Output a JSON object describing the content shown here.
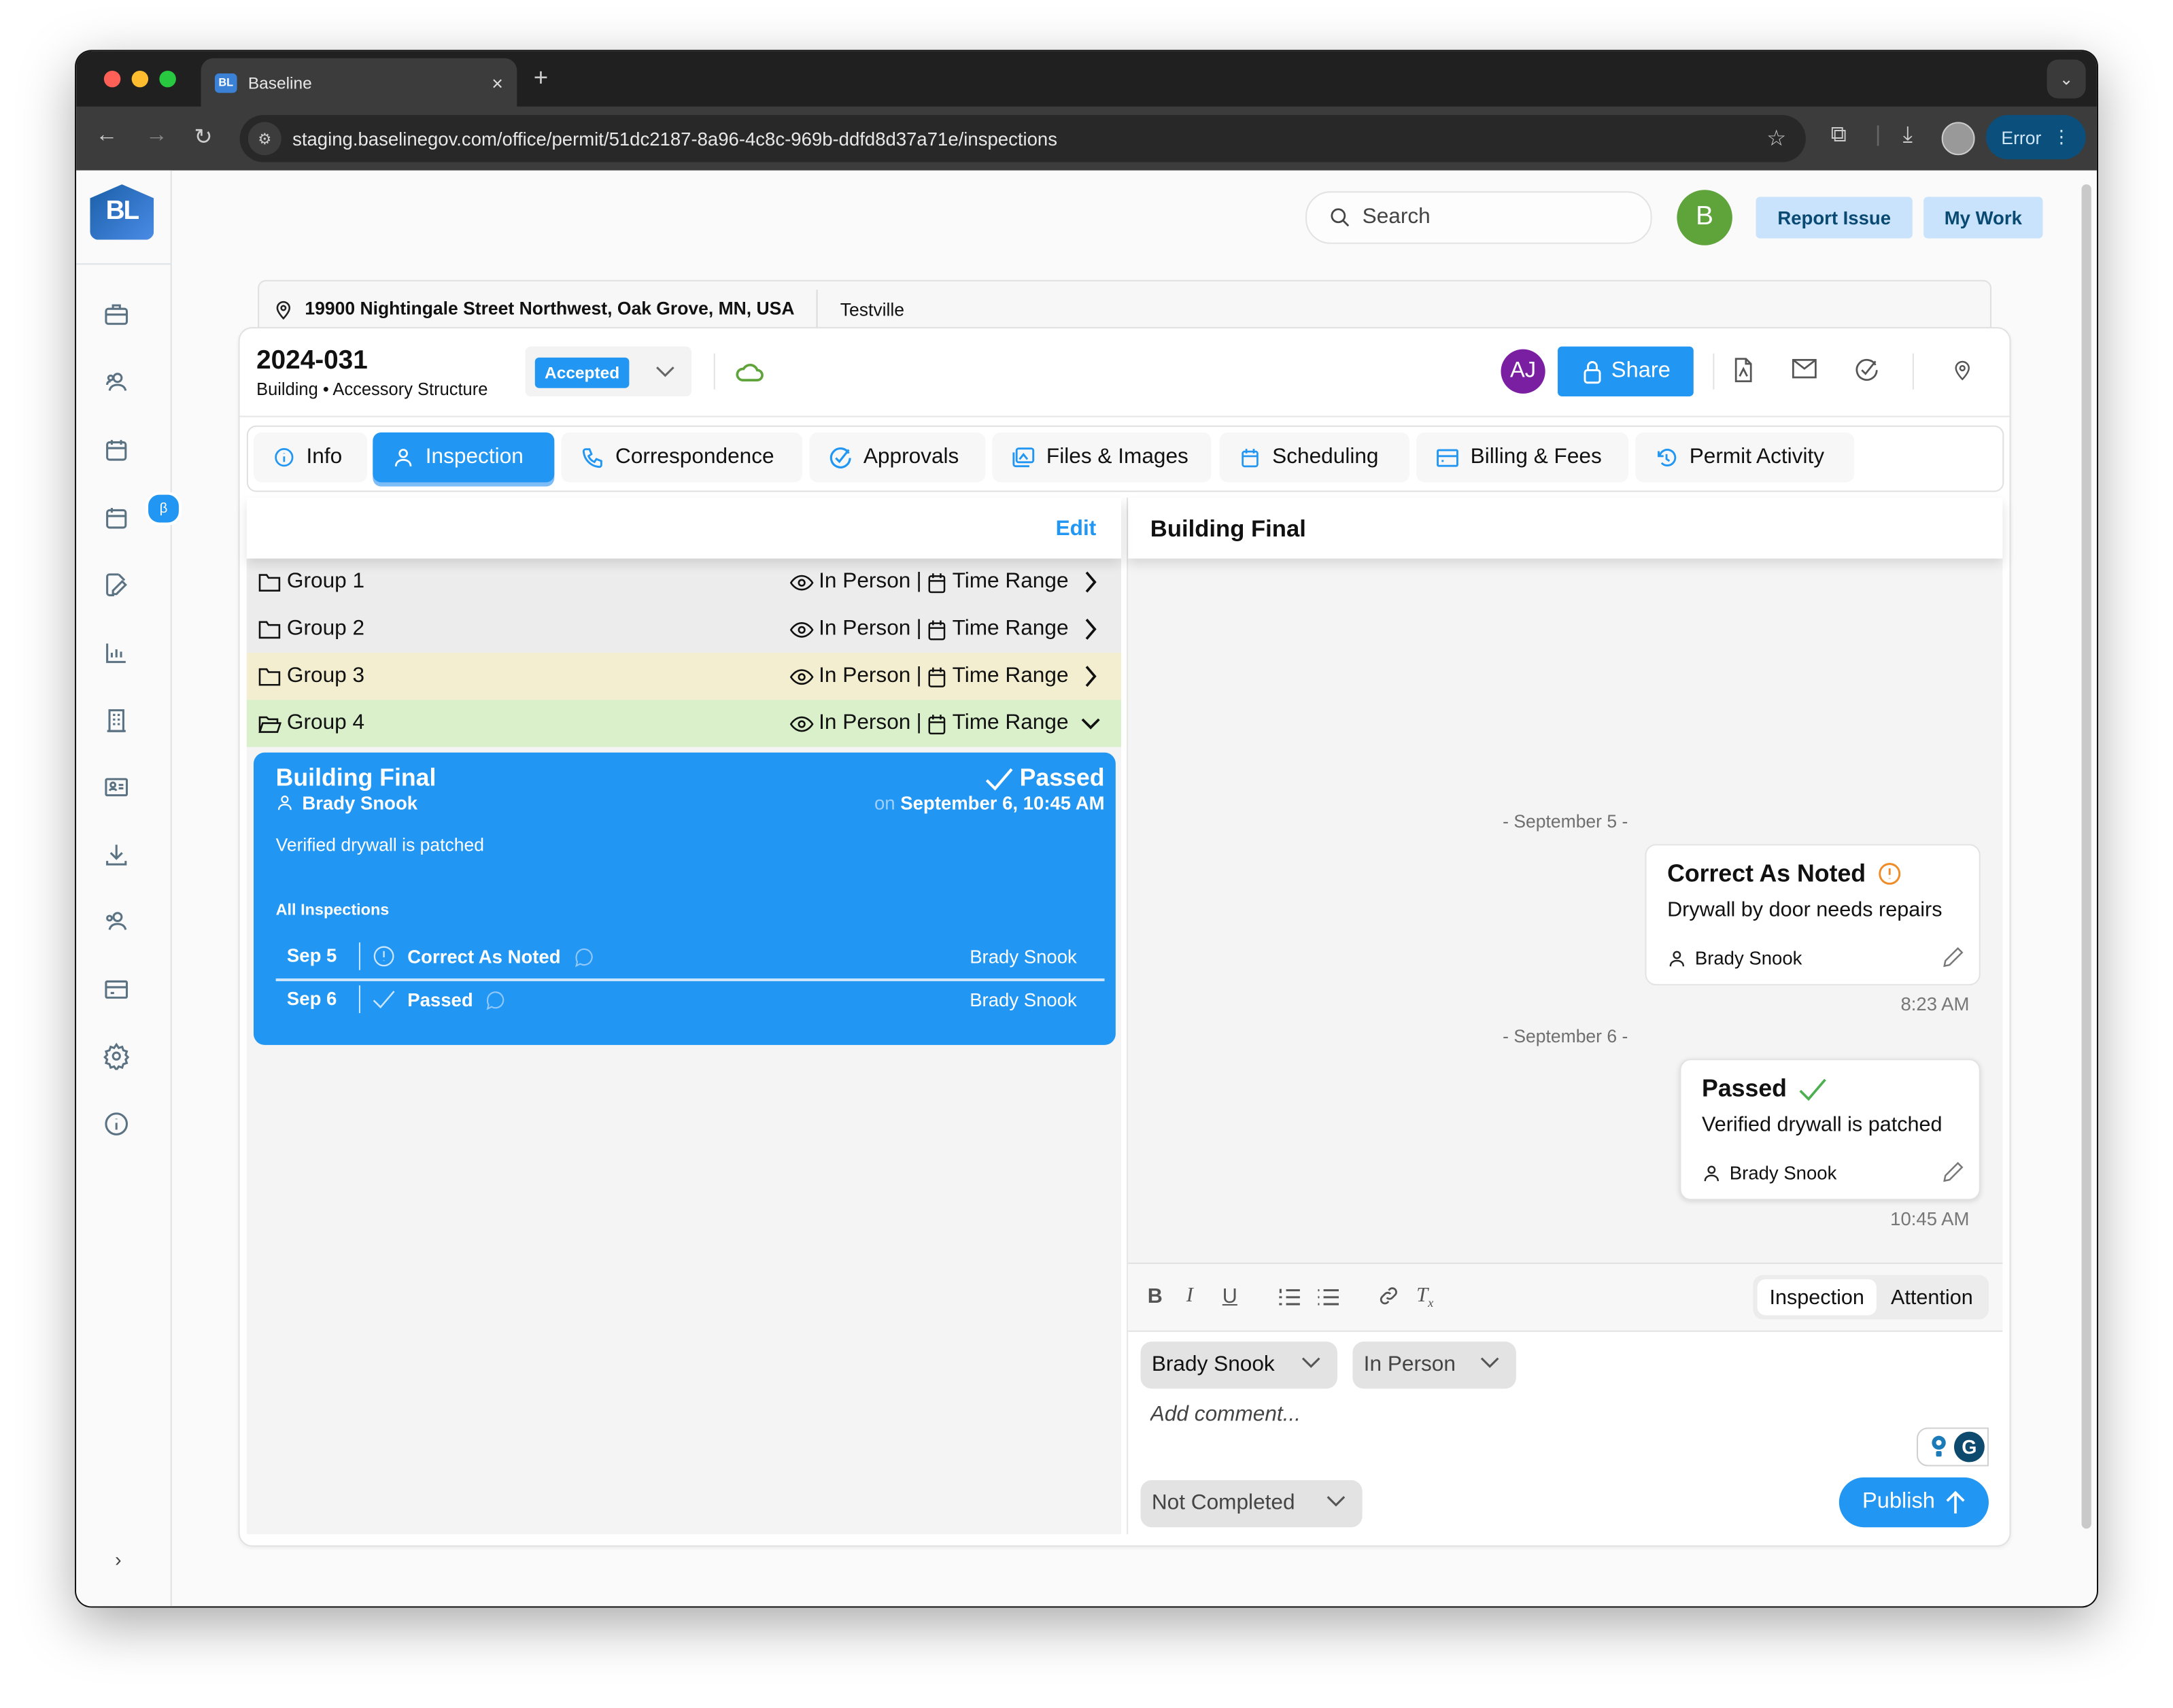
{
  "browser": {
    "tab_title": "Baseline",
    "tab_favicon": "BL",
    "url": "staging.baselinegov.com/office/permit/51dc2187-8a96-4c8c-969b-ddfd8d37a71e/inspections",
    "profile_button": "Error",
    "traffic_lights": [
      "#fe5f57",
      "#febc2e",
      "#28c840"
    ]
  },
  "header": {
    "search_placeholder": "Search",
    "user_initial": "B",
    "report_issue": "Report Issue",
    "my_work": "My Work"
  },
  "sidebar": {
    "logo": "BL",
    "beta_badge": "β",
    "items": [
      {
        "icon": "briefcase-icon"
      },
      {
        "icon": "users-icon"
      },
      {
        "icon": "calendar-icon"
      },
      {
        "icon": "calendar-beta-icon"
      },
      {
        "icon": "document-edit-icon"
      },
      {
        "icon": "chart-icon"
      },
      {
        "icon": "building-icon"
      },
      {
        "icon": "id-card-icon"
      },
      {
        "icon": "download-icon"
      },
      {
        "icon": "team-icon"
      },
      {
        "icon": "credit-card-icon"
      },
      {
        "icon": "gear-icon"
      },
      {
        "icon": "info-icon"
      }
    ],
    "expand": "›"
  },
  "address": {
    "street": "19900 Nightingale Street Northwest, Oak Grove, MN, USA",
    "jurisdiction": "Testville"
  },
  "permit": {
    "number": "2024-031",
    "type": "Building • Accessory Structure",
    "status": "Accepted",
    "assignee_initials": "AJ",
    "share_label": "Share"
  },
  "tabs": [
    {
      "label": "Info",
      "icon": "info-icon",
      "active": false
    },
    {
      "label": "Inspection",
      "icon": "user-icon",
      "active": true
    },
    {
      "label": "Correspondence",
      "icon": "phone-icon",
      "active": false
    },
    {
      "label": "Approvals",
      "icon": "check-circle-icon",
      "active": false
    },
    {
      "label": "Files & Images",
      "icon": "images-icon",
      "active": false
    },
    {
      "label": "Scheduling",
      "icon": "calendar-icon",
      "active": false
    },
    {
      "label": "Billing & Fees",
      "icon": "billing-icon",
      "active": false
    },
    {
      "label": "Permit Activity",
      "icon": "history-icon",
      "active": false
    }
  ],
  "left_pane": {
    "edit_label": "Edit",
    "groups": [
      {
        "name": "Group 1",
        "mode": "In Person",
        "sep": "|",
        "schedule": "Time Range",
        "expanded": false,
        "color": "#ececec"
      },
      {
        "name": "Group 2",
        "mode": "In Person",
        "sep": "|",
        "schedule": "Time Range",
        "expanded": false,
        "color": "#ececec"
      },
      {
        "name": "Group 3",
        "mode": "In Person",
        "sep": "|",
        "schedule": "Time Range",
        "expanded": false,
        "color": "#f3eed0"
      },
      {
        "name": "Group 4",
        "mode": "In Person",
        "sep": "|",
        "schedule": "Time Range",
        "expanded": true,
        "color": "#d9f0cb"
      }
    ],
    "selected_inspection": {
      "title": "Building Final",
      "inspector": "Brady Snook",
      "status": "Passed",
      "date_prefix": "on",
      "date": "September 6, 10:45 AM",
      "note": "Verified drywall is patched",
      "history_label": "All Inspections",
      "history": [
        {
          "date": "Sep 5",
          "status": "Correct As Noted",
          "status_icon": "alert-circle-icon",
          "inspector": "Brady Snook"
        },
        {
          "date": "Sep 6",
          "status": "Passed",
          "status_icon": "check-icon",
          "inspector": "Brady Snook"
        }
      ]
    }
  },
  "right_pane": {
    "title": "Building Final",
    "timeline": [
      {
        "day": "- September 5 -",
        "status": "Correct As Noted",
        "status_color": "#f08a24",
        "body": "Drywall by door needs repairs",
        "author": "Brady Snook",
        "time": "8:23 AM"
      },
      {
        "day": "- September 6 -",
        "status": "Passed",
        "status_color": "#4caf50",
        "body": "Verified drywall is patched",
        "author": "Brady Snook",
        "time": "10:45 AM"
      }
    ],
    "composer": {
      "mode_options": [
        "Inspection",
        "Attention"
      ],
      "mode_selected": "Inspection",
      "inspector_select": "Brady Snook",
      "type_select": "In Person",
      "comment_placeholder": "Add comment...",
      "result_select": "Not Completed",
      "publish_label": "Publish"
    }
  },
  "colors": {
    "accent": "#2196f3",
    "pill_bg": "#c8e3fb",
    "pill_text": "#0a4a72",
    "user_avatar": "#5fa33b",
    "assignee_avatar": "#7b1fa2"
  }
}
